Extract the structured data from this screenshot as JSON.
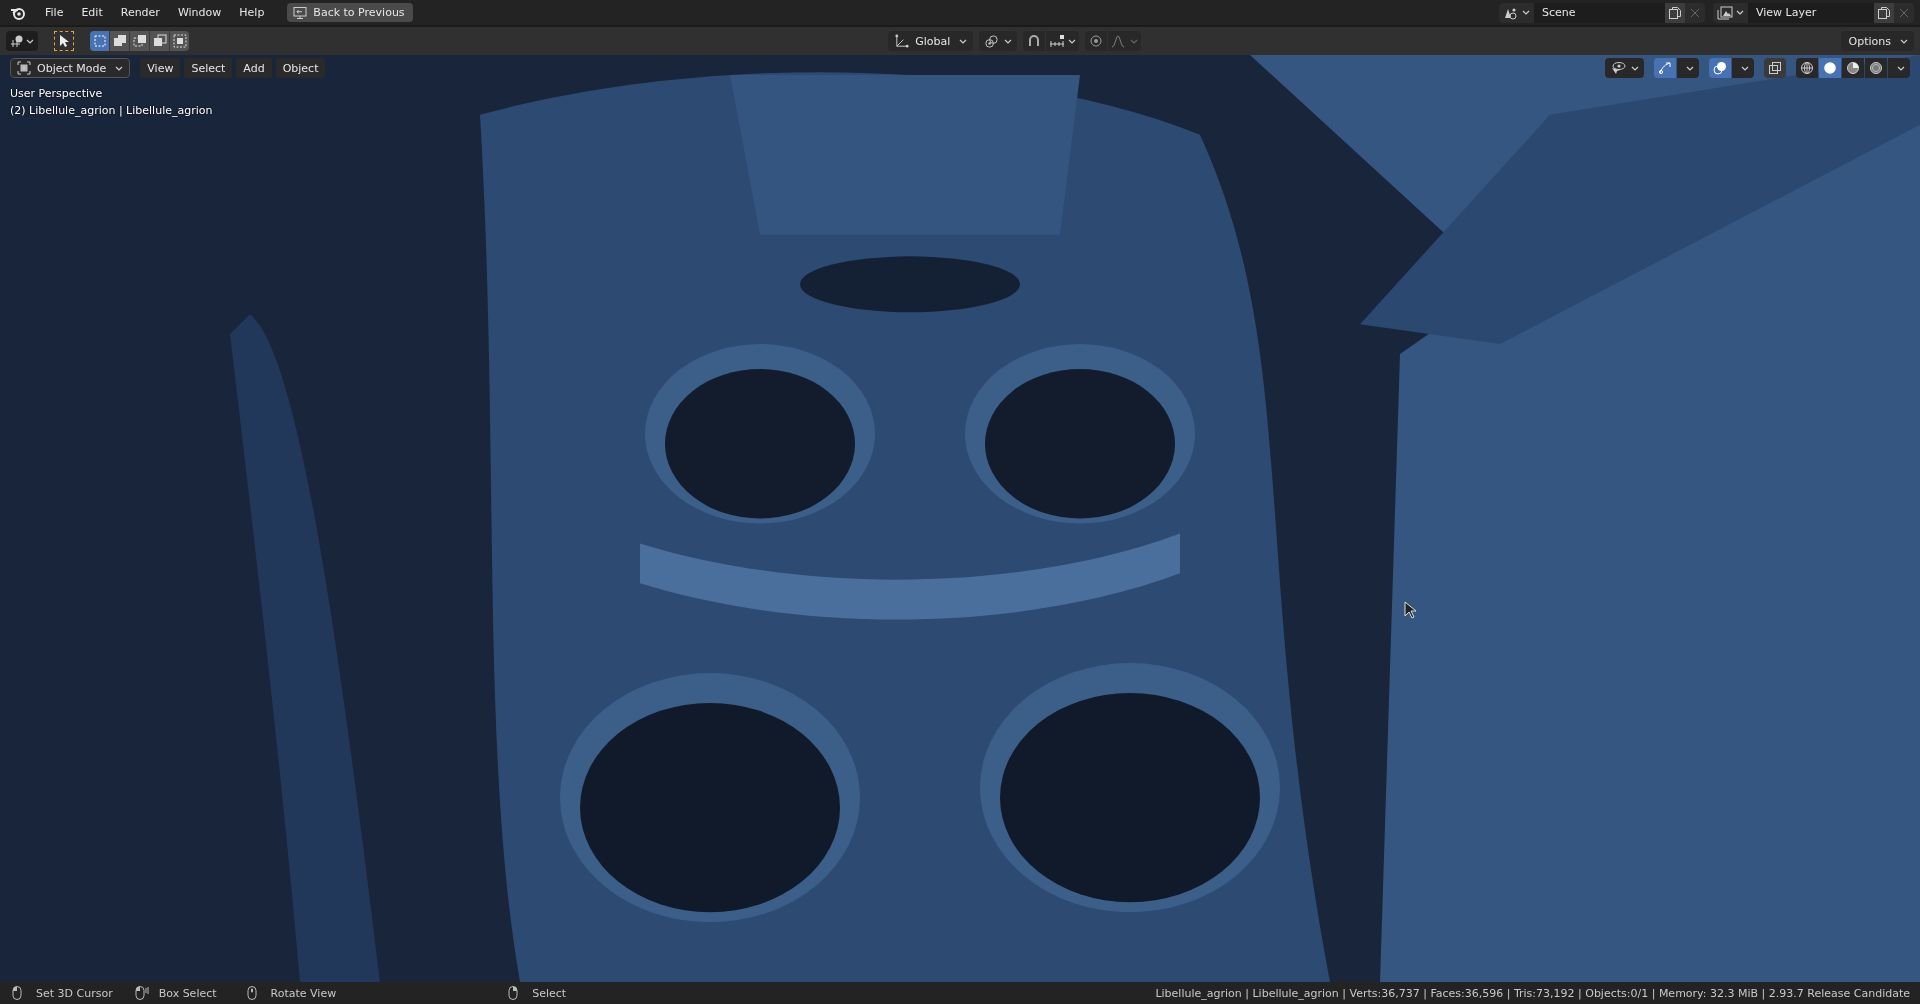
{
  "top_bar": {
    "menus": [
      "File",
      "Edit",
      "Render",
      "Window",
      "Help"
    ],
    "back_button": "Back to Previous",
    "scene": {
      "name": "Scene"
    },
    "view_layer": {
      "name": "View Layer"
    }
  },
  "tool_header": {
    "select_modes": [
      {
        "selected": true
      },
      {
        "selected": false
      },
      {
        "selected": false
      },
      {
        "selected": false
      },
      {
        "selected": false
      }
    ],
    "transform_orientation": "Global",
    "snap": {
      "on": false
    },
    "proportional_editing": {
      "on": false
    },
    "options": "Options"
  },
  "viewport_header": {
    "mode": "Object Mode",
    "menus": [
      "View",
      "Select",
      "Add",
      "Object"
    ],
    "gizmos": {
      "on": true
    },
    "overlays": {
      "on": true
    },
    "xray": {
      "on": false
    },
    "shading_modes": [
      {
        "selected": false
      },
      {
        "selected": true
      },
      {
        "selected": false
      },
      {
        "selected": false
      }
    ]
  },
  "viewport": {
    "perspective": "User Perspective",
    "object_info": "(2) Libellule_agrion | Libellule_agrion"
  },
  "status_bar": {
    "hints": [
      {
        "kind": "left",
        "label": "Set 3D Cursor"
      },
      {
        "kind": "drag",
        "label": "Box Select"
      },
      {
        "kind": "middle",
        "label": "Rotate View"
      },
      {
        "kind": "right",
        "label": "Select"
      }
    ],
    "stats": "Libellule_agrion | Libellule_agrion | Verts:36,737 | Faces:36,596 | Tris:73,192 | Objects:0/1 | Memory: 32.3 MiB | 2.93.7 Release Candidate"
  }
}
